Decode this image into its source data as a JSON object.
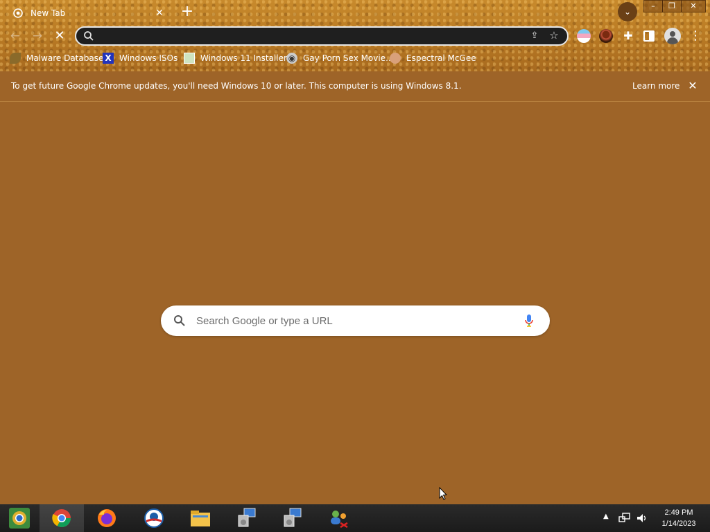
{
  "tab": {
    "title": "New Tab",
    "close_label": "✕"
  },
  "window": {
    "min": "–",
    "max": "❐",
    "close": "✕"
  },
  "omnibox": {
    "value": ""
  },
  "bookmarks": [
    {
      "label": "Malware Database",
      "icon": "leaf-icon"
    },
    {
      "label": "Windows ISOs",
      "icon": "x-icon"
    },
    {
      "label": "Windows 11 Installer",
      "icon": "image-icon"
    },
    {
      "label": "Gay Porn Sex Movie...",
      "icon": "disk-icon"
    },
    {
      "label": "Espectral McGee",
      "icon": "face-icon"
    }
  ],
  "infobar": {
    "message": "To get future Google Chrome updates, you'll need Windows 10 or later. This computer is using Windows 8.1.",
    "learn_more": "Learn more"
  },
  "search": {
    "placeholder": "Search Google or type a URL"
  },
  "taskbar": {
    "apps": [
      "chrome-canary-icon",
      "chrome-icon",
      "firefox-icon",
      "obama-logo-icon",
      "file-explorer-icon",
      "setup-icon",
      "setup-icon",
      "network-users-icon"
    ],
    "time": "2:49 PM",
    "date": "1/14/2023"
  },
  "colors": {
    "page_bg": "#9e6428",
    "frame": "#b97a24",
    "omnibox_bg": "#1f1f1f"
  }
}
